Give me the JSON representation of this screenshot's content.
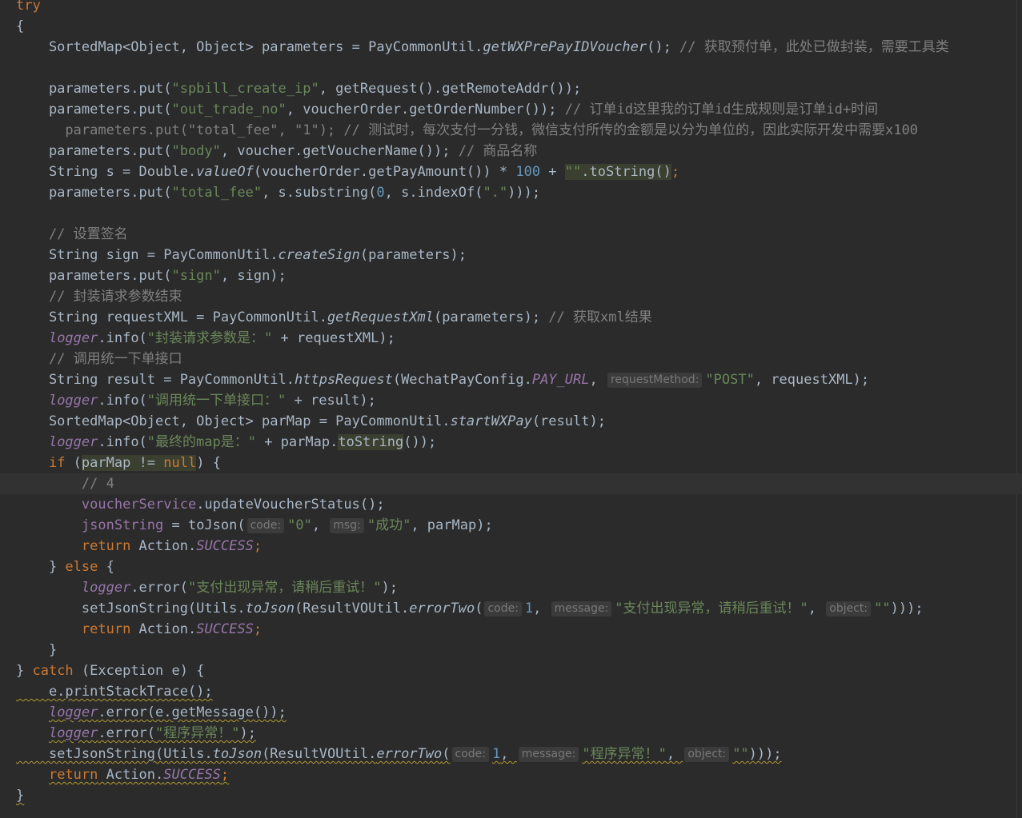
{
  "editor": {
    "language": "java",
    "lines": [
      [
        {
          "t": "try",
          "c": "kw"
        }
      ],
      [
        {
          "t": "{",
          "c": ""
        }
      ],
      [
        {
          "t": "    SortedMap<Object, Object> parameters = PayCommonUtil.",
          "c": ""
        },
        {
          "t": "getWXPrePayIDVoucher",
          "c": "static"
        },
        {
          "t": "(); ",
          "c": ""
        },
        {
          "t": "// 获取预付单，此处已做封装，需要工具类",
          "c": "cmt"
        }
      ],
      [
        {
          "t": "",
          "c": ""
        }
      ],
      [
        {
          "t": "    parameters.put(",
          "c": ""
        },
        {
          "t": "\"spbill_create_ip\"",
          "c": "str"
        },
        {
          "t": ", getRequest().getRemoteAddr());",
          "c": ""
        }
      ],
      [
        {
          "t": "    parameters.put(",
          "c": ""
        },
        {
          "t": "\"out_trade_no\"",
          "c": "str"
        },
        {
          "t": ", voucherOrder.getOrderNumber()); ",
          "c": ""
        },
        {
          "t": "// 订单id这里我的订单id生成规则是订单id+时间",
          "c": "cmt"
        }
      ],
      [
        {
          "t": "      parameters.put(\"total_fee\", \"1\"); // 测试时，每次支付一分钱，微信支付所传的金额是以分为单位的，因此实际开发中需要x100",
          "c": "cmt"
        }
      ],
      [
        {
          "t": "    parameters.put(",
          "c": ""
        },
        {
          "t": "\"body\"",
          "c": "str"
        },
        {
          "t": ", voucher.getVoucherName()); ",
          "c": ""
        },
        {
          "t": "// 商品名称",
          "c": "cmt"
        }
      ],
      [
        {
          "t": "    String s = Double.",
          "c": ""
        },
        {
          "t": "valueOf",
          "c": "static"
        },
        {
          "t": "(voucherOrder.getPayAmount()) * ",
          "c": ""
        },
        {
          "t": "100",
          "c": "num"
        },
        {
          "t": " + ",
          "c": ""
        },
        {
          "t": "\"\"",
          "c": "str hl"
        },
        {
          "t": ".toString()",
          "c": "hl"
        },
        {
          "t": ";",
          "c": "kw"
        }
      ],
      [
        {
          "t": "    parameters.put(",
          "c": ""
        },
        {
          "t": "\"total_fee\"",
          "c": "str"
        },
        {
          "t": ", s.substring(",
          "c": ""
        },
        {
          "t": "0",
          "c": "num"
        },
        {
          "t": ", s.indexOf(",
          "c": ""
        },
        {
          "t": "\".\"",
          "c": "str"
        },
        {
          "t": ")));",
          "c": ""
        }
      ],
      [
        {
          "t": "",
          "c": ""
        }
      ],
      [
        {
          "t": "    // 设置签名",
          "c": "cmt"
        }
      ],
      [
        {
          "t": "    String sign = PayCommonUtil.",
          "c": ""
        },
        {
          "t": "createSign",
          "c": "static"
        },
        {
          "t": "(parameters);",
          "c": ""
        }
      ],
      [
        {
          "t": "    parameters.put(",
          "c": ""
        },
        {
          "t": "\"sign\"",
          "c": "str"
        },
        {
          "t": ", sign);",
          "c": ""
        }
      ],
      [
        {
          "t": "    // 封装请求参数结束",
          "c": "cmt"
        }
      ],
      [
        {
          "t": "    String requestXML = PayCommonUtil.",
          "c": ""
        },
        {
          "t": "getRequestXml",
          "c": "static"
        },
        {
          "t": "(parameters); ",
          "c": ""
        },
        {
          "t": "// 获取xml结果",
          "c": "cmt"
        }
      ],
      [
        {
          "t": "    ",
          "c": ""
        },
        {
          "t": "logger",
          "c": "field-it"
        },
        {
          "t": ".info(",
          "c": ""
        },
        {
          "t": "\"封装请求参数是：\"",
          "c": "str"
        },
        {
          "t": " + requestXML);",
          "c": ""
        }
      ],
      [
        {
          "t": "    // 调用统一下单接口",
          "c": "cmt"
        }
      ],
      [
        {
          "t": "    String result = PayCommonUtil.",
          "c": ""
        },
        {
          "t": "httpsRequest",
          "c": "static"
        },
        {
          "t": "(WechatPayConfig.",
          "c": ""
        },
        {
          "t": "PAY_URL",
          "c": "field-it"
        },
        {
          "t": ", ",
          "c": ""
        },
        {
          "h": "requestMethod:"
        },
        {
          "t": "\"POST\"",
          "c": "str"
        },
        {
          "t": ", requestXML);",
          "c": ""
        }
      ],
      [
        {
          "t": "    ",
          "c": ""
        },
        {
          "t": "logger",
          "c": "field-it"
        },
        {
          "t": ".info(",
          "c": ""
        },
        {
          "t": "\"调用统一下单接口：\"",
          "c": "str"
        },
        {
          "t": " + result);",
          "c": ""
        }
      ],
      [
        {
          "t": "    SortedMap<Object, Object> parMap = PayCommonUtil.",
          "c": ""
        },
        {
          "t": "startWXPay",
          "c": "static"
        },
        {
          "t": "(result);",
          "c": ""
        }
      ],
      [
        {
          "t": "    ",
          "c": ""
        },
        {
          "t": "logger",
          "c": "field-it"
        },
        {
          "t": ".info(",
          "c": ""
        },
        {
          "t": "\"最终的map是：\"",
          "c": "str"
        },
        {
          "t": " + parMap.",
          "c": ""
        },
        {
          "t": "toString",
          "c": "hl"
        },
        {
          "t": "());",
          "c": ""
        }
      ],
      [
        {
          "t": "    ",
          "c": ""
        },
        {
          "t": "if",
          "c": "kw"
        },
        {
          "t": " (",
          "c": ""
        },
        {
          "t": "parMap != ",
          "c": "hl"
        },
        {
          "t": "null",
          "c": "kw hl"
        },
        {
          "t": ") {",
          "c": ""
        }
      ],
      [
        {
          "t": "        // 4",
          "c": "cmt"
        }
      ],
      [
        {
          "t": "        ",
          "c": ""
        },
        {
          "t": "voucherService",
          "c": "inst"
        },
        {
          "t": ".updateVoucherStatus();",
          "c": ""
        }
      ],
      [
        {
          "t": "        ",
          "c": ""
        },
        {
          "t": "jsonString",
          "c": "inst"
        },
        {
          "t": " = toJson(",
          "c": ""
        },
        {
          "h": "code:"
        },
        {
          "t": "\"0\"",
          "c": "str"
        },
        {
          "t": ", ",
          "c": ""
        },
        {
          "h": "msg:"
        },
        {
          "t": "\"成功\"",
          "c": "str"
        },
        {
          "t": ", parMap);",
          "c": ""
        }
      ],
      [
        {
          "t": "        ",
          "c": ""
        },
        {
          "t": "return",
          "c": "kw"
        },
        {
          "t": " Action.",
          "c": ""
        },
        {
          "t": "SUCCESS",
          "c": "field-it"
        },
        {
          "t": ";",
          "c": "kw"
        }
      ],
      [
        {
          "t": "    } ",
          "c": ""
        },
        {
          "t": "else",
          "c": "kw"
        },
        {
          "t": " {",
          "c": ""
        }
      ],
      [
        {
          "t": "        ",
          "c": ""
        },
        {
          "t": "logger",
          "c": "field-it"
        },
        {
          "t": ".error(",
          "c": ""
        },
        {
          "t": "\"支付出现异常，请稍后重试！\"",
          "c": "str"
        },
        {
          "t": ");",
          "c": ""
        }
      ],
      [
        {
          "t": "        setJsonString(Utils.",
          "c": ""
        },
        {
          "t": "toJson",
          "c": "static"
        },
        {
          "t": "(ResultVOUtil.",
          "c": ""
        },
        {
          "t": "errorTwo",
          "c": "static"
        },
        {
          "t": "(",
          "c": ""
        },
        {
          "h": "code:"
        },
        {
          "t": "1",
          "c": "num"
        },
        {
          "t": ", ",
          "c": ""
        },
        {
          "h": "message:"
        },
        {
          "t": "\"支付出现异常，请稍后重试！\"",
          "c": "str"
        },
        {
          "t": ", ",
          "c": ""
        },
        {
          "h": "object:"
        },
        {
          "t": "\"\"",
          "c": "str"
        },
        {
          "t": ")));",
          "c": ""
        }
      ],
      [
        {
          "t": "        ",
          "c": ""
        },
        {
          "t": "return",
          "c": "kw"
        },
        {
          "t": " Action.",
          "c": ""
        },
        {
          "t": "SUCCESS",
          "c": "field-it"
        },
        {
          "t": ";",
          "c": "kw"
        }
      ],
      [
        {
          "t": "    }",
          "c": ""
        }
      ],
      [
        {
          "t": "} ",
          "c": ""
        },
        {
          "t": "catch",
          "c": "kw"
        },
        {
          "t": " (Exception e) {",
          "c": ""
        }
      ],
      [
        {
          "t": "    e.printStackTrace();",
          "c": "warn"
        }
      ],
      [
        {
          "t": "    ",
          "c": ""
        },
        {
          "t": "logger",
          "c": "field-it warn"
        },
        {
          "t": ".error(e.getMessage());",
          "c": "warn"
        }
      ],
      [
        {
          "t": "    ",
          "c": ""
        },
        {
          "t": "logger",
          "c": "field-it warn"
        },
        {
          "t": ".error(",
          "c": "warn"
        },
        {
          "t": "\"程序异常！\"",
          "c": "str warn"
        },
        {
          "t": ");",
          "c": "warn"
        }
      ],
      [
        {
          "t": "    setJsonString(Utils.",
          "c": "warn"
        },
        {
          "t": "toJson",
          "c": "static warn"
        },
        {
          "t": "(ResultVOUtil.",
          "c": "warn"
        },
        {
          "t": "errorTwo",
          "c": "static warn"
        },
        {
          "t": "(",
          "c": "warn"
        },
        {
          "h": "code:"
        },
        {
          "t": "1",
          "c": "num warn"
        },
        {
          "t": ", ",
          "c": "warn"
        },
        {
          "h": "message:"
        },
        {
          "t": "\"程序异常！\"",
          "c": "str warn"
        },
        {
          "t": ", ",
          "c": "warn"
        },
        {
          "h": "object:"
        },
        {
          "t": "\"\"",
          "c": "str warn"
        },
        {
          "t": ")));",
          "c": "warn"
        }
      ],
      [
        {
          "t": "    ",
          "c": ""
        },
        {
          "t": "return",
          "c": "kw warn"
        },
        {
          "t": " Action.",
          "c": "warn"
        },
        {
          "t": "SUCCESS",
          "c": "field-it warn"
        },
        {
          "t": ";",
          "c": "kw warn"
        }
      ],
      [
        {
          "t": "}",
          "c": "warn"
        }
      ]
    ],
    "current_line": 23
  }
}
